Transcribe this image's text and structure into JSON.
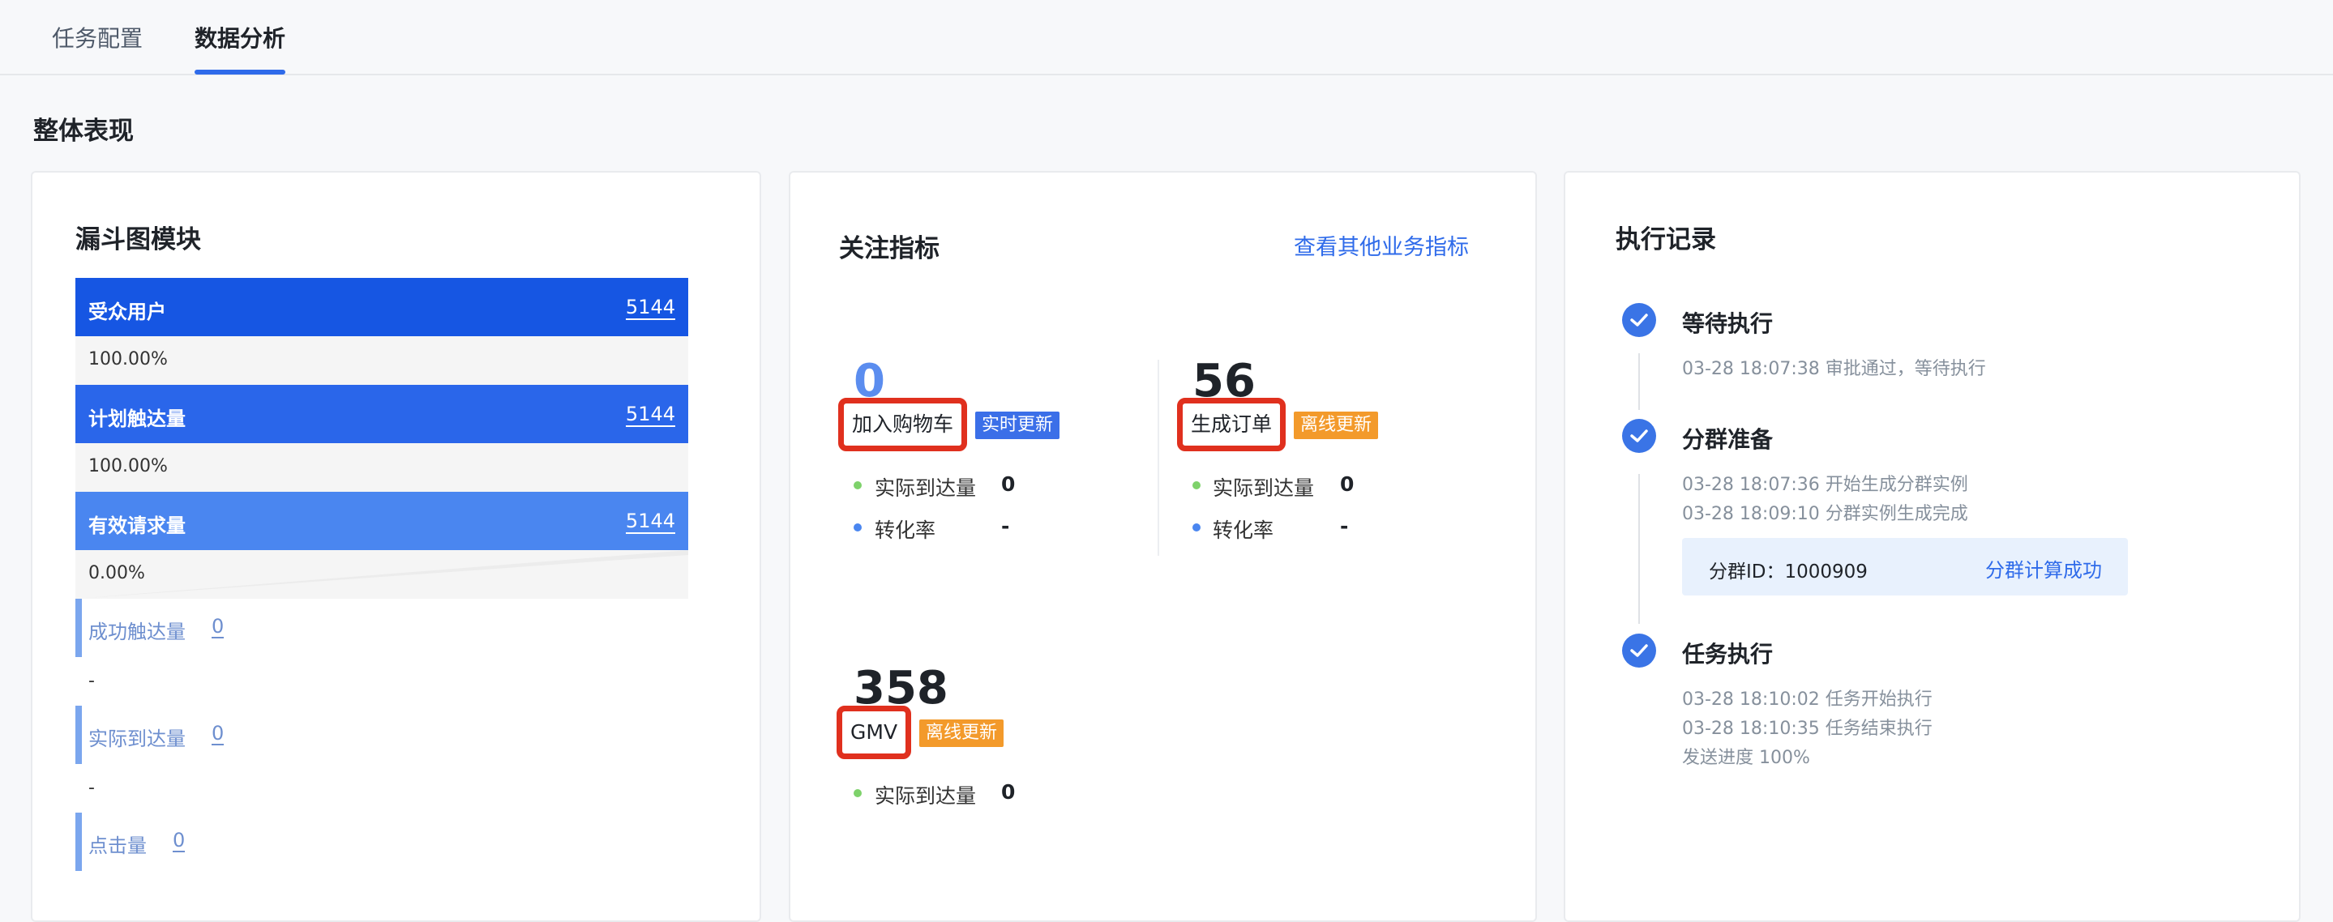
{
  "tabs": [
    {
      "label": "任务配置",
      "active": false
    },
    {
      "label": "数据分析",
      "active": true
    }
  ],
  "section_title": "整体表现",
  "funnel": {
    "title": "漏斗图模块",
    "bars": [
      {
        "label": "受众用户",
        "value": "5144",
        "color": "#1656e3"
      },
      {
        "label": "计划触达量",
        "value": "5144",
        "color": "#2a66ea"
      },
      {
        "label": "有效请求量",
        "value": "5144",
        "color": "#4a86f0"
      }
    ],
    "percents": [
      "100.00%",
      "100.00%",
      "0.00%"
    ],
    "small_items": [
      {
        "label": "成功触达量",
        "value": "0"
      },
      {
        "label": "实际到达量",
        "value": "0"
      },
      {
        "label": "点击量",
        "value": "0"
      }
    ],
    "dash": "-"
  },
  "metrics": {
    "title": "关注指标",
    "link": "查看其他业务指标",
    "items": [
      {
        "value": "0",
        "value_color": "#5b8def",
        "label": "加入购物车",
        "badge": "实时更新",
        "badge_color": "blue",
        "rows": [
          {
            "label": "实际到达量",
            "value": "0",
            "dot": "#7ed26b"
          },
          {
            "label": "转化率",
            "value": "-",
            "dot": "#4a86f0"
          }
        ]
      },
      {
        "value": "56",
        "value_color": "#1f2329",
        "label": "生成订单",
        "badge": "离线更新",
        "badge_color": "orange",
        "rows": [
          {
            "label": "实际到达量",
            "value": "0",
            "dot": "#7ed26b"
          },
          {
            "label": "转化率",
            "value": "-",
            "dot": "#4a86f0"
          }
        ]
      },
      {
        "value": "358",
        "value_color": "#1f2329",
        "label": "GMV",
        "badge": "离线更新",
        "badge_color": "orange",
        "rows": [
          {
            "label": "实际到达量",
            "value": "0",
            "dot": "#7ed26b"
          }
        ]
      }
    ]
  },
  "execution": {
    "title": "执行记录",
    "steps": [
      {
        "title": "等待执行",
        "lines": [
          "03-28 18:07:38 审批通过，等待执行"
        ]
      },
      {
        "title": "分群准备",
        "lines": [
          "03-28 18:07:36 开始生成分群实例",
          "03-28 18:09:10 分群实例生成完成"
        ]
      },
      {
        "title": "任务执行",
        "lines": [
          "03-28 18:10:02 任务开始执行",
          "03-28 18:10:35 任务结束执行",
          "发送进度 100%"
        ]
      }
    ],
    "group": {
      "id_label": "分群ID：1000909",
      "status": "分群计算成功"
    }
  }
}
